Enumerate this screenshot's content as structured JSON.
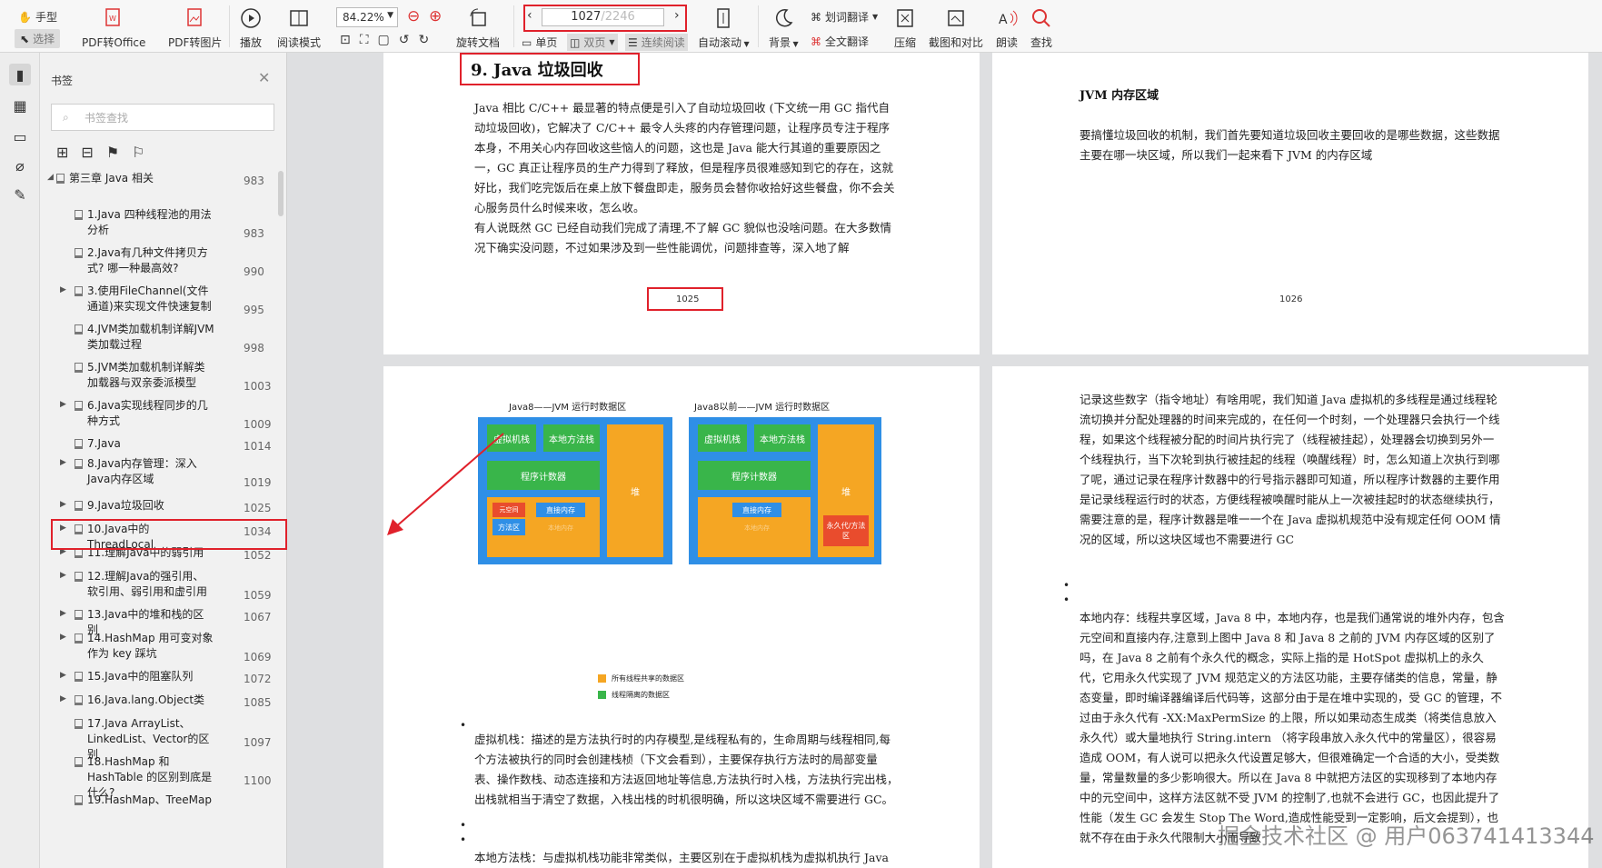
{
  "toolbar": {
    "hand": "手型",
    "select": "选择",
    "pdf_to_office": "PDF转Office",
    "pdf_to_image": "PDF转图片",
    "play": "播放",
    "read_mode": "阅读模式",
    "zoom": "84.22%",
    "rotate": "旋转文档",
    "page_current": "1027",
    "page_total": "/2246",
    "single": "单页",
    "double": "双页",
    "continuous": "连续阅读",
    "auto_scroll": "自动滚动",
    "background": "背景",
    "word_translate": "划词翻译",
    "full_translate": "全文翻译",
    "compress": "压缩",
    "screenshot_compare": "截图和对比",
    "read_aloud": "朗读",
    "find": "查找"
  },
  "panel": {
    "title": "书签",
    "search_placeholder": "书签查找"
  },
  "bookmarks": [
    {
      "label": "第三章 Java 相关",
      "page": "983"
    },
    {
      "label": "1.Java 四种线程池的用法分析",
      "page": "983"
    },
    {
      "label": "2.Java有几种文件拷贝方式? 哪一种最高效?",
      "page": "990"
    },
    {
      "label": "3.使用FileChannel(文件通道)来实现文件快速复制",
      "page": "995"
    },
    {
      "label": "4.JVM类加载机制详解JVM类加载过程",
      "page": "998"
    },
    {
      "label": "5.JVM类加载机制详解类加载器与双亲委派模型",
      "page": "1003"
    },
    {
      "label": "6.Java实现线程同步的几种方式",
      "page": "1009"
    },
    {
      "label": "7.Java",
      "page": "1014"
    },
    {
      "label": "8.Java内存管理：深入Java内存区域",
      "page": "1019"
    },
    {
      "label": "9.Java垃圾回收",
      "page": "1025"
    },
    {
      "label": "10.Java中的ThreadLocal",
      "page": "1034"
    },
    {
      "label": "11.理解Java中的弱引用",
      "page": "1052"
    },
    {
      "label": "12.理解Java的强引用、软引用、弱引用和虚引用",
      "page": "1059"
    },
    {
      "label": "13.Java中的堆和栈的区别",
      "page": "1067"
    },
    {
      "label": "14.HashMap 用可变对象作为 key 踩坑",
      "page": "1069"
    },
    {
      "label": "15.Java中的阻塞队列",
      "page": "1072"
    },
    {
      "label": "16.Java.lang.Object类",
      "page": "1085"
    },
    {
      "label": "17.Java ArrayList、LinkedList、Vector的区别",
      "page": "1097"
    },
    {
      "label": "18.HashMap 和 HashTable 的区别到底是什么?",
      "page": "1100"
    },
    {
      "label": "19.HashMap、TreeMap",
      "page": ""
    }
  ],
  "page1025": {
    "heading": "9. Java 垃圾回收",
    "para1": "Java 相比 C/C++ 最显著的特点便是引入了自动垃圾回收 (下文统一用 GC 指代自动垃圾回收)，它解决了 C/C++ 最令人头疼的内存管理问题，让程序员专注于程序本身，不用关心内存回收这些恼人的问题，这也是 Java 能大行其道的重要原因之一，GC 真正让程序员的生产力得到了释放，但是程序员很难感知到它的存在，这就好比，我们吃完饭后在桌上放下餐盘即走，服务员会替你收拾好这些餐盘，你不会关心服务员什么时候来收，怎么收。",
    "para2": "有人说既然 GC 已经自动我们完成了清理,不了解 GC 貌似也没啥问题。在大多数情况下确实没问题，不过如果涉及到一些性能调优，问题排查等，深入地了解",
    "number": "1025"
  },
  "page1026": {
    "heading": "JVM 内存区域",
    "para": "要搞懂垃圾回收的机制，我们首先要知道垃圾回收主要回收的是哪些数据，这些数据主要在哪一块区域，所以我们一起来看下 JVM 的内存区域",
    "number": "1026"
  },
  "page1027": {
    "diag1_title": "Java8——JVM 运行时数据区",
    "diag2_title": "Java8以前——JVM 运行时数据区",
    "vm_stack": "虚拟机栈",
    "native_stack": "本地方法栈",
    "pc": "程序计数器",
    "heap": "堆",
    "metaspace": "元空间",
    "method_area": "方法区",
    "direct_mem": "直接内存",
    "native_mem": "本地内存",
    "permgen": "永久代/方法区",
    "legend_shared": "所有线程共享的数据区",
    "legend_private": "线程隔离的数据区",
    "para1": "虚拟机栈：描述的是方法执行时的内存模型,是线程私有的，生命周期与线程相同,每个方法被执行的同时会创建栈桢（下文会看到），主要保存执行方法时的局部变量表、操作数栈、动态连接和方法返回地址等信息,方法执行时入栈，方法执行完出栈，出栈就相当于清空了数据，入栈出栈的时机很明确，所以这块区域不需要进行 GC。",
    "para2": "本地方法栈：与虚拟机栈功能非常类似，主要区别在于虚拟机栈为虚拟机执行 Java 方法时服务，而本地方法栈为虚拟机执行本地方法时服务的。这块区域也不需要进行 GC"
  },
  "page1028": {
    "para1": "记录这些数字（指令地址）有啥用呢，我们知道 Java 虚拟机的多线程是通过线程轮流切换并分配处理器的时间来完成的，在任何一个时刻，一个处理器只会执行一个线程，如果这个线程被分配的时间片执行完了（线程被挂起），处理器会切换到另外一个线程执行，当下次轮到执行被挂起的线程（唤醒线程）时，怎么知道上次执行到哪了呢，通过记录在程序计数器中的行号指示器即可知道，所以程序计数器的主要作用是记录线程运行时的状态，方便线程被唤醒时能从上一次被挂起时的状态继续执行，需要注意的是，程序计数器是唯一一个在 Java 虚拟机规范中没有规定任何 OOM 情况的区域，所以这块区域也不需要进行 GC",
    "para2": "本地内存：线程共享区域，Java 8 中，本地内存，也是我们通常说的堆外内存，包含元空间和直接内存,注意到上图中 Java 8 和 Java 8 之前的 JVM 内存区域的区别了吗，在 Java 8 之前有个永久代的概念，实际上指的是 HotSpot 虚拟机上的永久代，它用永久代实现了 JVM 规范定义的方法区功能，主要存储类的信息，常量，静态变量，即时编译器编译后代码等，这部分由于是在堆中实现的，受 GC 的管理，不过由于永久代有 -XX:MaxPermSize 的上限，所以如果动态生成类（将类信息放入永久代）或大量地执行 String.intern （将字段串放入永久代中的常量区），很容易造成 OOM，有人说可以把永久代设置足够大，但很难确定一个合适的大小，受类数量，常量数量的多少影响很大。所以在 Java 8 中就把方法区的实现移到了本地内存中的元空间中，这样方法区就不受 JVM 的控制了,也就不会进行 GC，也因此提升了性能（发生 GC 会发生 Stop The Word,造成性能受到一定影响，后文会提到），也就不存在由于永久代限制大小而导致"
  },
  "watermark": "掘金技术社区 @ 用户063741413344",
  "colors": {
    "highlight_red": "#e0212b",
    "diagram_blue": "#2f8fe6",
    "diagram_green": "#39b54a",
    "diagram_orange": "#f5a623"
  }
}
